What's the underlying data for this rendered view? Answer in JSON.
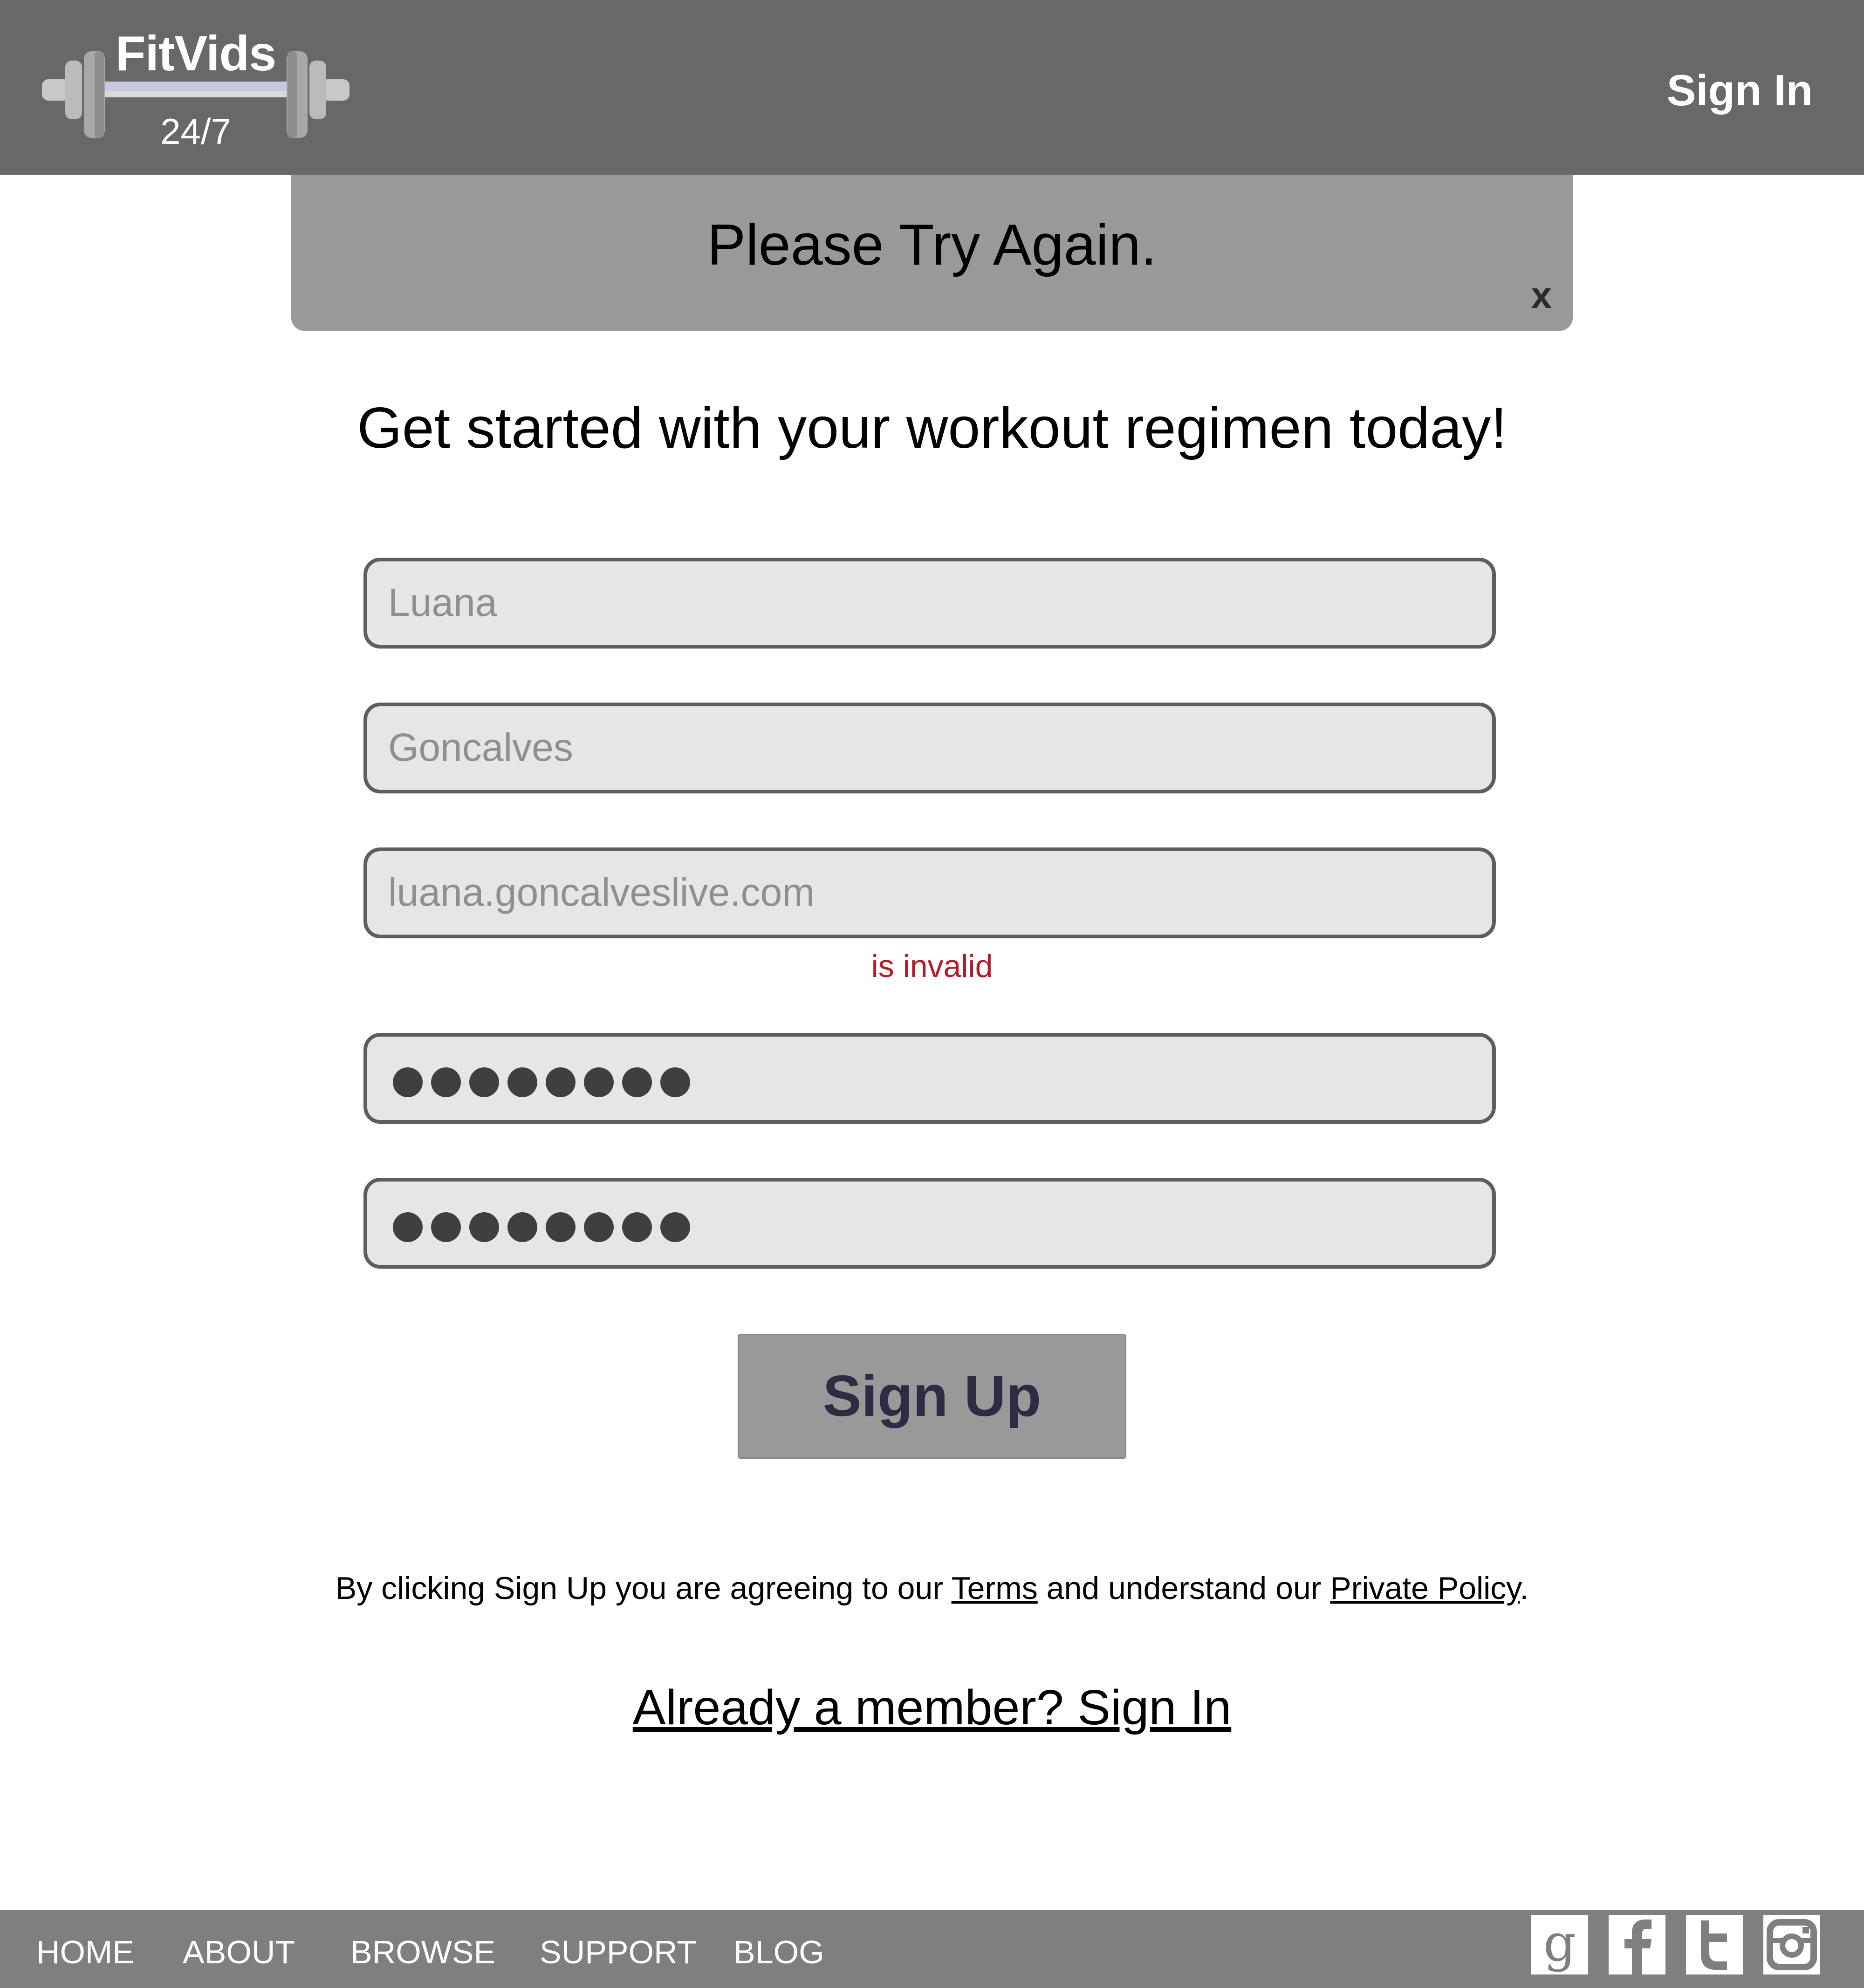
{
  "header": {
    "logo_title": "FitVids",
    "logo_subtitle": "24/7",
    "sign_in_label": "Sign In"
  },
  "banner": {
    "message": "Please Try Again.",
    "close_label": "x"
  },
  "main": {
    "headline": "Get started with your workout regimen today!",
    "fields": {
      "first_name": "Luana",
      "last_name": "Goncalves",
      "email": "luana.goncalveslive.com",
      "password_dots": 8,
      "confirm_password_dots": 8
    },
    "email_error": "is invalid",
    "signup_label": "Sign Up",
    "legal": {
      "prefix": "By clicking Sign Up you are agreeing to our ",
      "terms": "Terms",
      "middle": " and understand our ",
      "policy": "Private Policy",
      "suffix": "."
    },
    "member_link": "Already a member? Sign In"
  },
  "footer": {
    "nav": [
      "HOME",
      "ABOUT",
      "BROWSE",
      "SUPPORT",
      "BLOG"
    ],
    "social_icons": [
      "google-icon",
      "facebook-icon",
      "twitter-icon",
      "instagram-icon"
    ]
  },
  "colors": {
    "header_bg": "#686868",
    "banner_bg": "#999999",
    "field_bg": "#e6e6e6",
    "error": "#b31b2a",
    "footer_bg": "#7f7f7f"
  }
}
